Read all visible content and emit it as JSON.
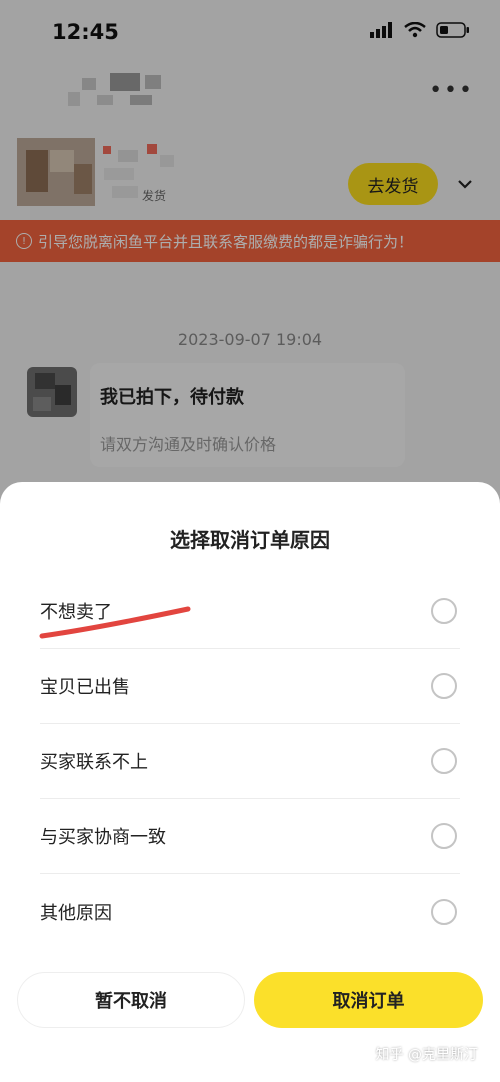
{
  "status_bar": {
    "time": "12:45"
  },
  "header": {
    "more_label": "•••"
  },
  "order_card": {
    "status_text": "发货",
    "ship_button": "去发货"
  },
  "warning": {
    "text": "引导您脱离闲鱼平台并且联系客服缴费的都是诈骗行为！"
  },
  "chat": {
    "timestamp": "2023-09-07 19:04",
    "message_title": "我已拍下，待付款",
    "message_subtitle": "请双方沟通及时确认价格"
  },
  "sheet": {
    "title": "选择取消订单原因",
    "reasons": [
      "不想卖了",
      "宝贝已出售",
      "买家联系不上",
      "与买家协商一致",
      "其他原因"
    ],
    "keep_button": "暂不取消",
    "cancel_button": "取消订单"
  },
  "watermark": "知乎 @克里斯汀",
  "colors": {
    "accent_yellow": "#f9dc1e",
    "warning_red": "#f2643f",
    "annotation_red": "#e2453f"
  }
}
